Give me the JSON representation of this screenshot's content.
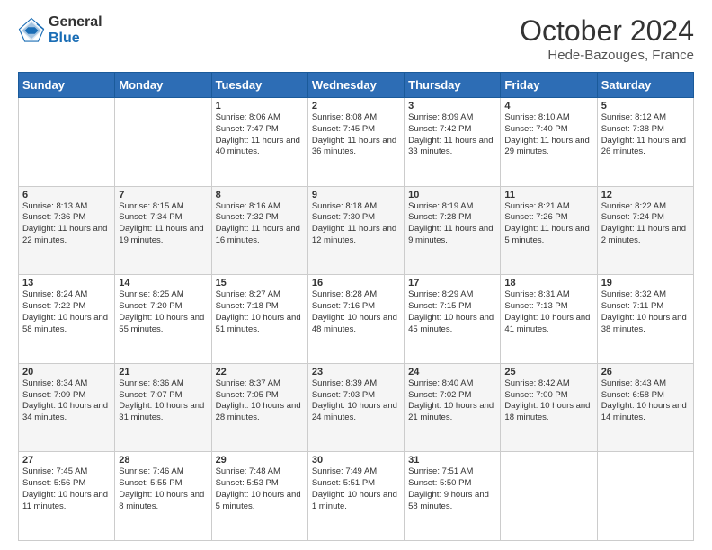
{
  "logo": {
    "general": "General",
    "blue": "Blue"
  },
  "header": {
    "month": "October 2024",
    "location": "Hede-Bazouges, France"
  },
  "weekdays": [
    "Sunday",
    "Monday",
    "Tuesday",
    "Wednesday",
    "Thursday",
    "Friday",
    "Saturday"
  ],
  "weeks": [
    [
      {
        "day": "",
        "sunrise": "",
        "sunset": "",
        "daylight": ""
      },
      {
        "day": "",
        "sunrise": "",
        "sunset": "",
        "daylight": ""
      },
      {
        "day": "1",
        "sunrise": "Sunrise: 8:06 AM",
        "sunset": "Sunset: 7:47 PM",
        "daylight": "Daylight: 11 hours and 40 minutes."
      },
      {
        "day": "2",
        "sunrise": "Sunrise: 8:08 AM",
        "sunset": "Sunset: 7:45 PM",
        "daylight": "Daylight: 11 hours and 36 minutes."
      },
      {
        "day": "3",
        "sunrise": "Sunrise: 8:09 AM",
        "sunset": "Sunset: 7:42 PM",
        "daylight": "Daylight: 11 hours and 33 minutes."
      },
      {
        "day": "4",
        "sunrise": "Sunrise: 8:10 AM",
        "sunset": "Sunset: 7:40 PM",
        "daylight": "Daylight: 11 hours and 29 minutes."
      },
      {
        "day": "5",
        "sunrise": "Sunrise: 8:12 AM",
        "sunset": "Sunset: 7:38 PM",
        "daylight": "Daylight: 11 hours and 26 minutes."
      }
    ],
    [
      {
        "day": "6",
        "sunrise": "Sunrise: 8:13 AM",
        "sunset": "Sunset: 7:36 PM",
        "daylight": "Daylight: 11 hours and 22 minutes."
      },
      {
        "day": "7",
        "sunrise": "Sunrise: 8:15 AM",
        "sunset": "Sunset: 7:34 PM",
        "daylight": "Daylight: 11 hours and 19 minutes."
      },
      {
        "day": "8",
        "sunrise": "Sunrise: 8:16 AM",
        "sunset": "Sunset: 7:32 PM",
        "daylight": "Daylight: 11 hours and 16 minutes."
      },
      {
        "day": "9",
        "sunrise": "Sunrise: 8:18 AM",
        "sunset": "Sunset: 7:30 PM",
        "daylight": "Daylight: 11 hours and 12 minutes."
      },
      {
        "day": "10",
        "sunrise": "Sunrise: 8:19 AM",
        "sunset": "Sunset: 7:28 PM",
        "daylight": "Daylight: 11 hours and 9 minutes."
      },
      {
        "day": "11",
        "sunrise": "Sunrise: 8:21 AM",
        "sunset": "Sunset: 7:26 PM",
        "daylight": "Daylight: 11 hours and 5 minutes."
      },
      {
        "day": "12",
        "sunrise": "Sunrise: 8:22 AM",
        "sunset": "Sunset: 7:24 PM",
        "daylight": "Daylight: 11 hours and 2 minutes."
      }
    ],
    [
      {
        "day": "13",
        "sunrise": "Sunrise: 8:24 AM",
        "sunset": "Sunset: 7:22 PM",
        "daylight": "Daylight: 10 hours and 58 minutes."
      },
      {
        "day": "14",
        "sunrise": "Sunrise: 8:25 AM",
        "sunset": "Sunset: 7:20 PM",
        "daylight": "Daylight: 10 hours and 55 minutes."
      },
      {
        "day": "15",
        "sunrise": "Sunrise: 8:27 AM",
        "sunset": "Sunset: 7:18 PM",
        "daylight": "Daylight: 10 hours and 51 minutes."
      },
      {
        "day": "16",
        "sunrise": "Sunrise: 8:28 AM",
        "sunset": "Sunset: 7:16 PM",
        "daylight": "Daylight: 10 hours and 48 minutes."
      },
      {
        "day": "17",
        "sunrise": "Sunrise: 8:29 AM",
        "sunset": "Sunset: 7:15 PM",
        "daylight": "Daylight: 10 hours and 45 minutes."
      },
      {
        "day": "18",
        "sunrise": "Sunrise: 8:31 AM",
        "sunset": "Sunset: 7:13 PM",
        "daylight": "Daylight: 10 hours and 41 minutes."
      },
      {
        "day": "19",
        "sunrise": "Sunrise: 8:32 AM",
        "sunset": "Sunset: 7:11 PM",
        "daylight": "Daylight: 10 hours and 38 minutes."
      }
    ],
    [
      {
        "day": "20",
        "sunrise": "Sunrise: 8:34 AM",
        "sunset": "Sunset: 7:09 PM",
        "daylight": "Daylight: 10 hours and 34 minutes."
      },
      {
        "day": "21",
        "sunrise": "Sunrise: 8:36 AM",
        "sunset": "Sunset: 7:07 PM",
        "daylight": "Daylight: 10 hours and 31 minutes."
      },
      {
        "day": "22",
        "sunrise": "Sunrise: 8:37 AM",
        "sunset": "Sunset: 7:05 PM",
        "daylight": "Daylight: 10 hours and 28 minutes."
      },
      {
        "day": "23",
        "sunrise": "Sunrise: 8:39 AM",
        "sunset": "Sunset: 7:03 PM",
        "daylight": "Daylight: 10 hours and 24 minutes."
      },
      {
        "day": "24",
        "sunrise": "Sunrise: 8:40 AM",
        "sunset": "Sunset: 7:02 PM",
        "daylight": "Daylight: 10 hours and 21 minutes."
      },
      {
        "day": "25",
        "sunrise": "Sunrise: 8:42 AM",
        "sunset": "Sunset: 7:00 PM",
        "daylight": "Daylight: 10 hours and 18 minutes."
      },
      {
        "day": "26",
        "sunrise": "Sunrise: 8:43 AM",
        "sunset": "Sunset: 6:58 PM",
        "daylight": "Daylight: 10 hours and 14 minutes."
      }
    ],
    [
      {
        "day": "27",
        "sunrise": "Sunrise: 7:45 AM",
        "sunset": "Sunset: 5:56 PM",
        "daylight": "Daylight: 10 hours and 11 minutes."
      },
      {
        "day": "28",
        "sunrise": "Sunrise: 7:46 AM",
        "sunset": "Sunset: 5:55 PM",
        "daylight": "Daylight: 10 hours and 8 minutes."
      },
      {
        "day": "29",
        "sunrise": "Sunrise: 7:48 AM",
        "sunset": "Sunset: 5:53 PM",
        "daylight": "Daylight: 10 hours and 5 minutes."
      },
      {
        "day": "30",
        "sunrise": "Sunrise: 7:49 AM",
        "sunset": "Sunset: 5:51 PM",
        "daylight": "Daylight: 10 hours and 1 minute."
      },
      {
        "day": "31",
        "sunrise": "Sunrise: 7:51 AM",
        "sunset": "Sunset: 5:50 PM",
        "daylight": "Daylight: 9 hours and 58 minutes."
      },
      {
        "day": "",
        "sunrise": "",
        "sunset": "",
        "daylight": ""
      },
      {
        "day": "",
        "sunrise": "",
        "sunset": "",
        "daylight": ""
      }
    ]
  ]
}
